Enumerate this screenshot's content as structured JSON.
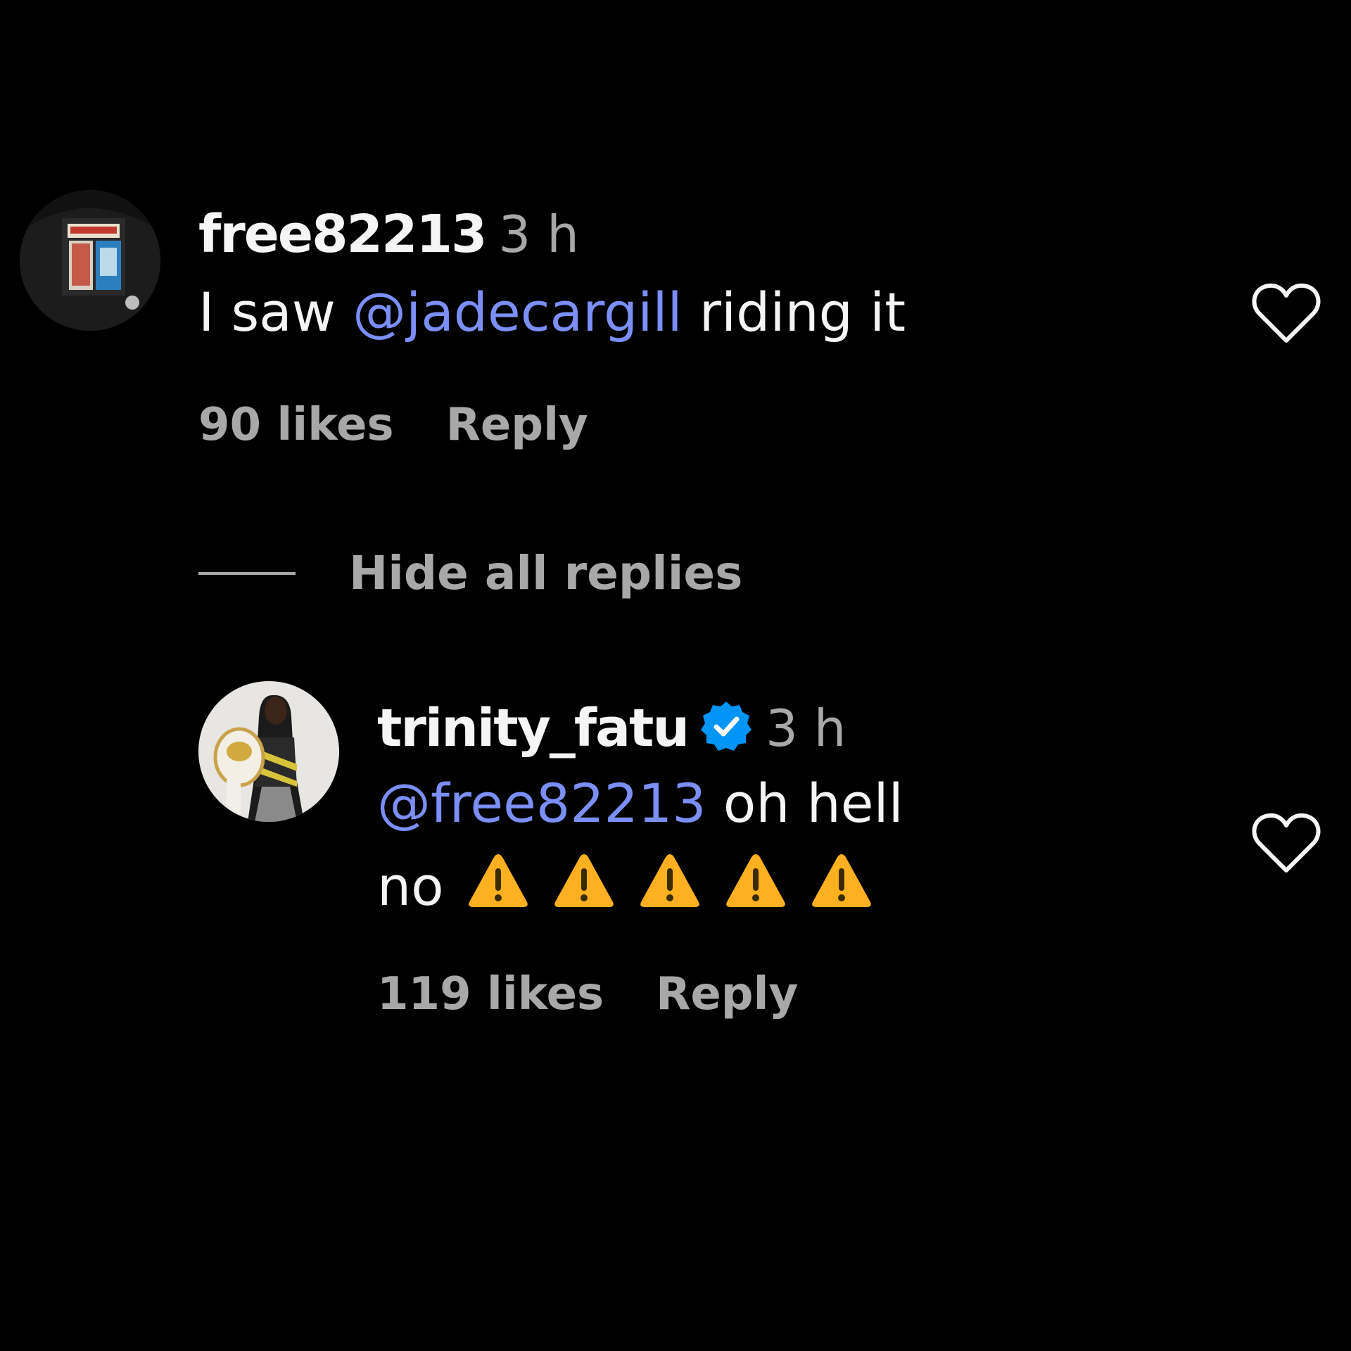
{
  "thread": {
    "comment": {
      "username": "free82213",
      "time": "3 h",
      "text_before": "I saw",
      "mention": "@jadecargill",
      "text_after": "riding it",
      "likes": "90 likes",
      "reply_label": "Reply"
    },
    "toggle_replies_label": "Hide all replies",
    "reply": {
      "username": "trinity_fatu",
      "verified": true,
      "time": "3 h",
      "mention": "@free82213",
      "text_line1": "oh hell",
      "text_line2": "no",
      "emoji": [
        "⚠️",
        "⚠️",
        "⚠️",
        "⚠️",
        "⚠️"
      ],
      "likes": "119 likes",
      "reply_label": "Reply"
    }
  },
  "colors": {
    "background": "#000000",
    "text": "#f5f5f5",
    "muted": "#a8a8a8",
    "mention": "#7b8ff7",
    "verified_badge": "#0095f6",
    "warning_emoji": "#ffb020"
  },
  "icons": {
    "like": "heart-outline-icon",
    "verified": "verified-badge-icon",
    "warning": "warning-sign-emoji"
  }
}
